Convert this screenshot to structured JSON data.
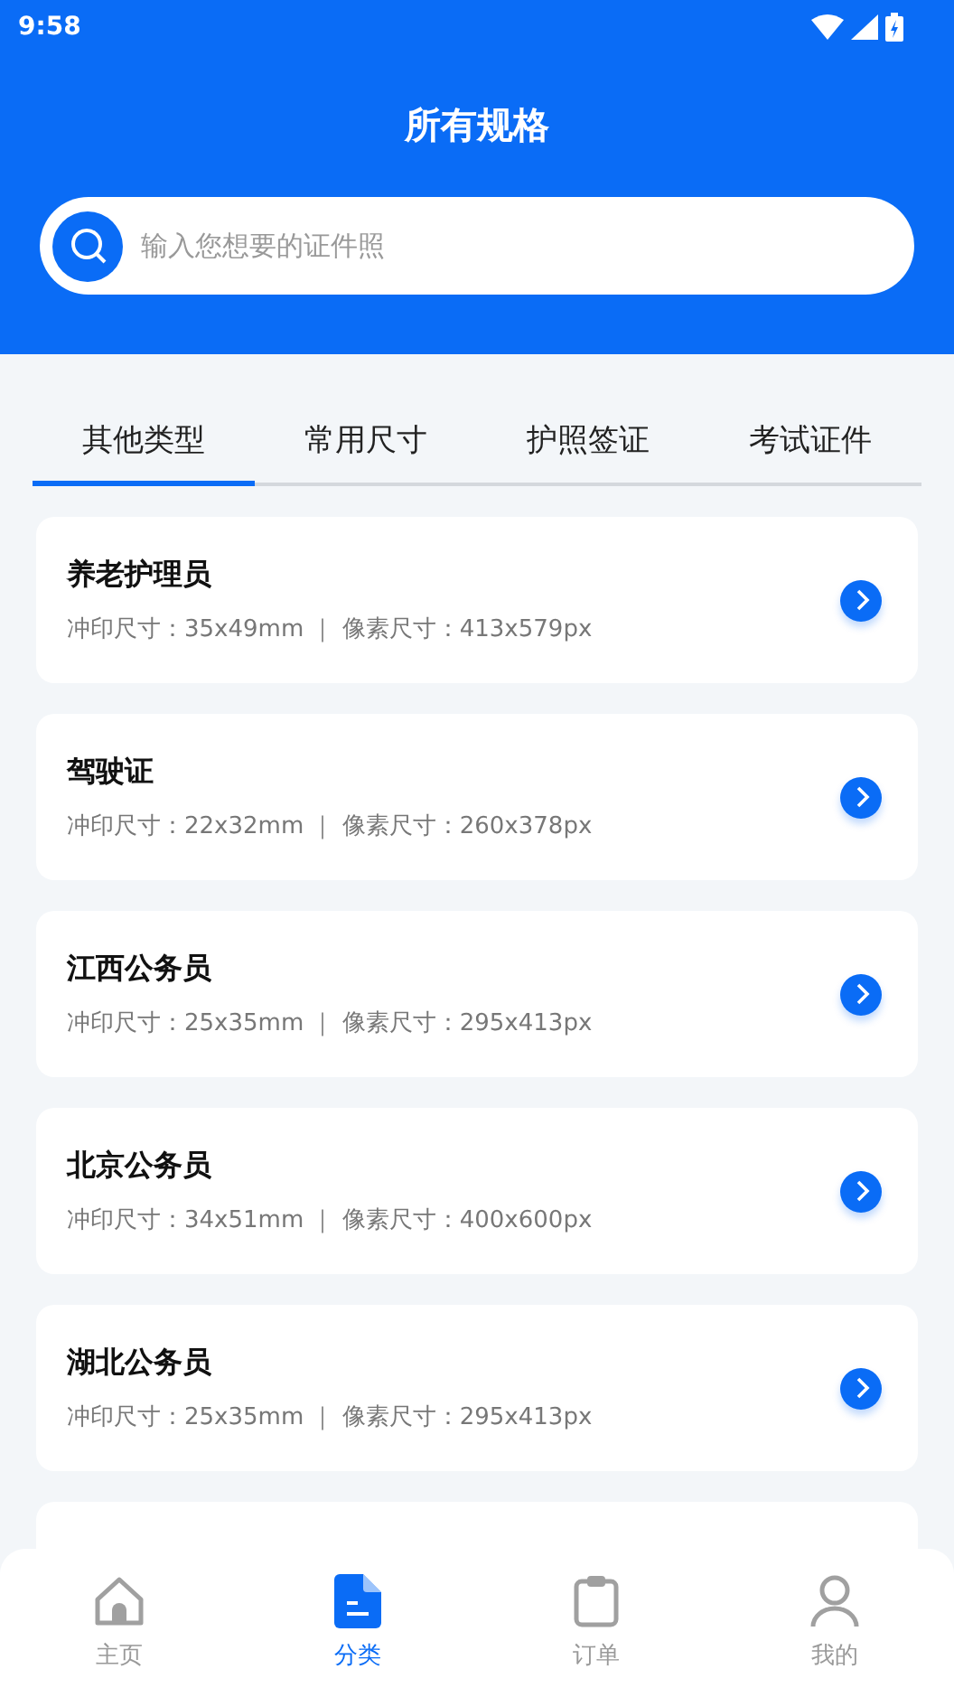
{
  "status_bar": {
    "time": "9:58"
  },
  "header": {
    "title": "所有规格"
  },
  "search": {
    "placeholder": "输入您想要的证件照"
  },
  "tabs": [
    {
      "label": "其他类型",
      "selected": true
    },
    {
      "label": "常用尺寸",
      "selected": false
    },
    {
      "label": "护照签证",
      "selected": false
    },
    {
      "label": "考试证件",
      "selected": false
    }
  ],
  "specs": [
    {
      "name": "养老护理员",
      "detail": "冲印尺寸：35x49mm ｜ 像素尺寸：413x579px"
    },
    {
      "name": "驾驶证",
      "detail": "冲印尺寸：22x32mm ｜ 像素尺寸：260x378px"
    },
    {
      "name": "江西公务员",
      "detail": "冲印尺寸：25x35mm ｜ 像素尺寸：295x413px"
    },
    {
      "name": "北京公务员",
      "detail": "冲印尺寸：34x51mm ｜ 像素尺寸：400x600px"
    },
    {
      "name": "湖北公务员",
      "detail": "冲印尺寸：25x35mm ｜ 像素尺寸：295x413px"
    }
  ],
  "bottom_nav": [
    {
      "kind": "home",
      "label": "主页",
      "selected": false
    },
    {
      "kind": "category",
      "label": "分类",
      "selected": true
    },
    {
      "kind": "order",
      "label": "订单",
      "selected": false
    },
    {
      "kind": "profile",
      "label": "我的",
      "selected": false
    }
  ]
}
